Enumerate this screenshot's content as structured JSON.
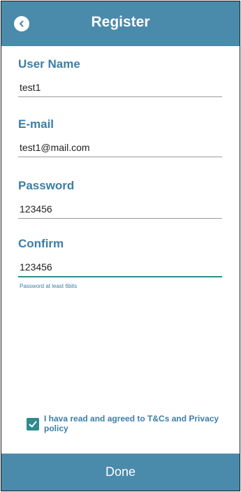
{
  "header": {
    "title": "Register",
    "back_icon": "chevron-left-icon"
  },
  "form": {
    "username": {
      "label": "User Name",
      "value": "test1"
    },
    "email": {
      "label": "E-mail",
      "value": "test1@mail.com"
    },
    "password": {
      "label": "Password",
      "value": "123456"
    },
    "confirm": {
      "label": "Confirm",
      "value": "123456",
      "hint": "Password at least 6bits"
    }
  },
  "agreement": {
    "checked": true,
    "text": "I hava read and agreed to T&Cs and Privacy policy"
  },
  "footer": {
    "done_label": "Done"
  },
  "colors": {
    "header_bg": "#4a8aab",
    "label": "#3c7ea6",
    "accent": "#2e8b8f"
  }
}
